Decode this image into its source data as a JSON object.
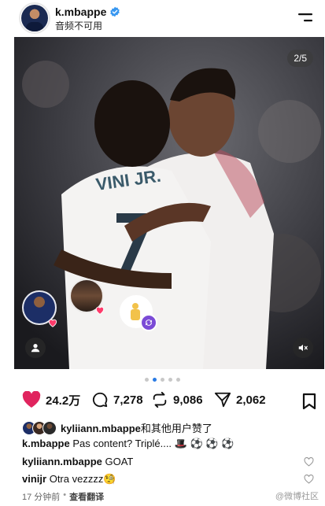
{
  "header": {
    "username": "k.mbappe",
    "subtitle": "音频不可用"
  },
  "post": {
    "page_indicator": "2/5",
    "carousel_dots": 5,
    "carousel_active_index": 1
  },
  "actions": {
    "likes": "24.2万",
    "comments": "7,278",
    "reposts": "9,086",
    "shares": "2,062"
  },
  "likes_line": {
    "user": "kyliiann.mbappe",
    "suffix": "和其他用户赞了"
  },
  "caption": {
    "user": "k.mbappe",
    "text": "Pas content? Triplé.... 🎩 ⚽ ⚽ ⚽"
  },
  "comments": [
    {
      "user": "kyliiann.mbappe",
      "text": "GOAT"
    },
    {
      "user": "vinijr",
      "text": "Otra vezzzz🧐"
    }
  ],
  "meta": {
    "time": "17 分钟前",
    "separator": "•",
    "translate": "查看翻译"
  },
  "watermark": "@微博社区",
  "colors": {
    "heart": "#e0245e",
    "verified": "#3897f0",
    "active_dot": "#2a7be4",
    "photo_bg": "#2a2a2e"
  }
}
